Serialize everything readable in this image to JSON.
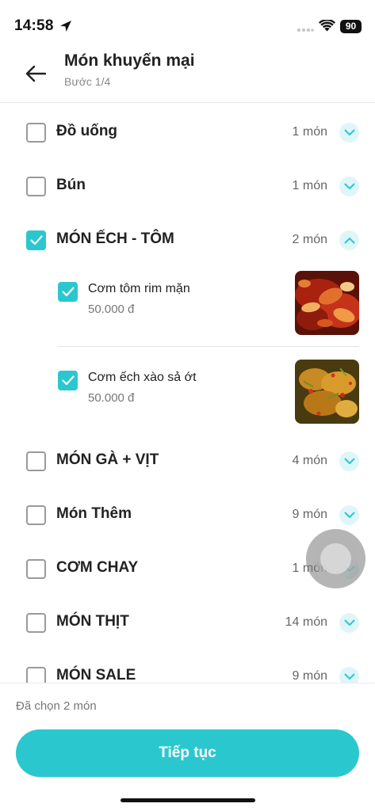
{
  "status_bar": {
    "time": "14:58",
    "battery": "90"
  },
  "header": {
    "title": "Món khuyến mại",
    "step": "Bước 1/4"
  },
  "categories": [
    {
      "name": "Đồ uống",
      "count": "1 món",
      "checked": false,
      "expanded": false
    },
    {
      "name": "Bún",
      "count": "1 món",
      "checked": false,
      "expanded": false
    },
    {
      "name": "MÓN ẾCH - TÔM",
      "count": "2 món",
      "checked": true,
      "expanded": true,
      "dishes": [
        {
          "name": "Cơm tôm rim mặn",
          "price": "50.000 đ",
          "checked": true
        },
        {
          "name": "Cơm ếch xào sả ớt",
          "price": "50.000 đ",
          "checked": true
        }
      ]
    },
    {
      "name": "MÓN GÀ + VỊT",
      "count": "4 món",
      "checked": false,
      "expanded": false
    },
    {
      "name": "Món Thêm",
      "count": "9 món",
      "checked": false,
      "expanded": false
    },
    {
      "name": "CƠM CHAY",
      "count": "1 món",
      "checked": false,
      "expanded": false
    },
    {
      "name": "MÓN THỊT",
      "count": "14 món",
      "checked": false,
      "expanded": false
    },
    {
      "name": "MÓN SALE",
      "count": "9 món",
      "checked": false,
      "expanded": false
    }
  ],
  "footer": {
    "selected_text": "Đã chọn 2 món",
    "continue_label": "Tiếp tục"
  },
  "colors": {
    "accent": "#2bc7cf",
    "chevron_bg": "#dff6f8"
  }
}
